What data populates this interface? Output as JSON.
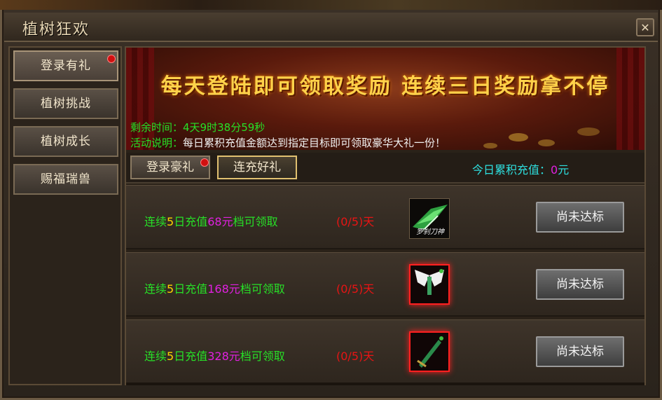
{
  "window": {
    "title": "植树狂欢",
    "close_glyph": "✕"
  },
  "sidebar": {
    "items": [
      {
        "label": "登录有礼",
        "badge": true
      },
      {
        "label": "植树挑战",
        "badge": false
      },
      {
        "label": "植树成长",
        "badge": false
      },
      {
        "label": "赐福瑞兽",
        "badge": false
      }
    ]
  },
  "banner": {
    "headline": "每天登陆即可领取奖励 连续三日奖励拿不停",
    "remaining_label": "剩余时间：",
    "remaining_value": "4天9时38分59秒",
    "desc_label": "活动说明：",
    "desc_value": "每日累积充值金额达到指定目标即可领取豪华大礼一份！"
  },
  "tabs": [
    {
      "label": "登录豪礼",
      "badge": true
    },
    {
      "label": "连充好礼",
      "selected": true
    }
  ],
  "today_recharge": {
    "label": "今日累积充值：",
    "value": "0",
    "unit": "元"
  },
  "rewards": [
    {
      "pre": "连续",
      "days": "5",
      "mid": "日充值",
      "amount": "68元",
      "post": "档可领取",
      "progress": "(0/5)天",
      "item_name": "罗刹刀神",
      "item_icon": "winged-blade-icon",
      "button": "尚未达标"
    },
    {
      "pre": "连续",
      "days": "5",
      "mid": "日充值",
      "amount": "168元",
      "post": "档可领取",
      "progress": "(0/5)天",
      "item_name": "",
      "item_icon": "angel-wings-icon",
      "button": "尚未达标"
    },
    {
      "pre": "连续",
      "days": "5",
      "mid": "日充值",
      "amount": "328元",
      "post": "档可领取",
      "progress": "(0/5)天",
      "item_name": "",
      "item_icon": "jade-sword-icon",
      "button": "尚未达标"
    }
  ],
  "colors": {
    "green": "#27e027",
    "yellow": "#ffd400",
    "magenta": "#e020e0",
    "red": "#e81414",
    "cyan": "#2ee0e0",
    "gold": "#ffd24a"
  }
}
